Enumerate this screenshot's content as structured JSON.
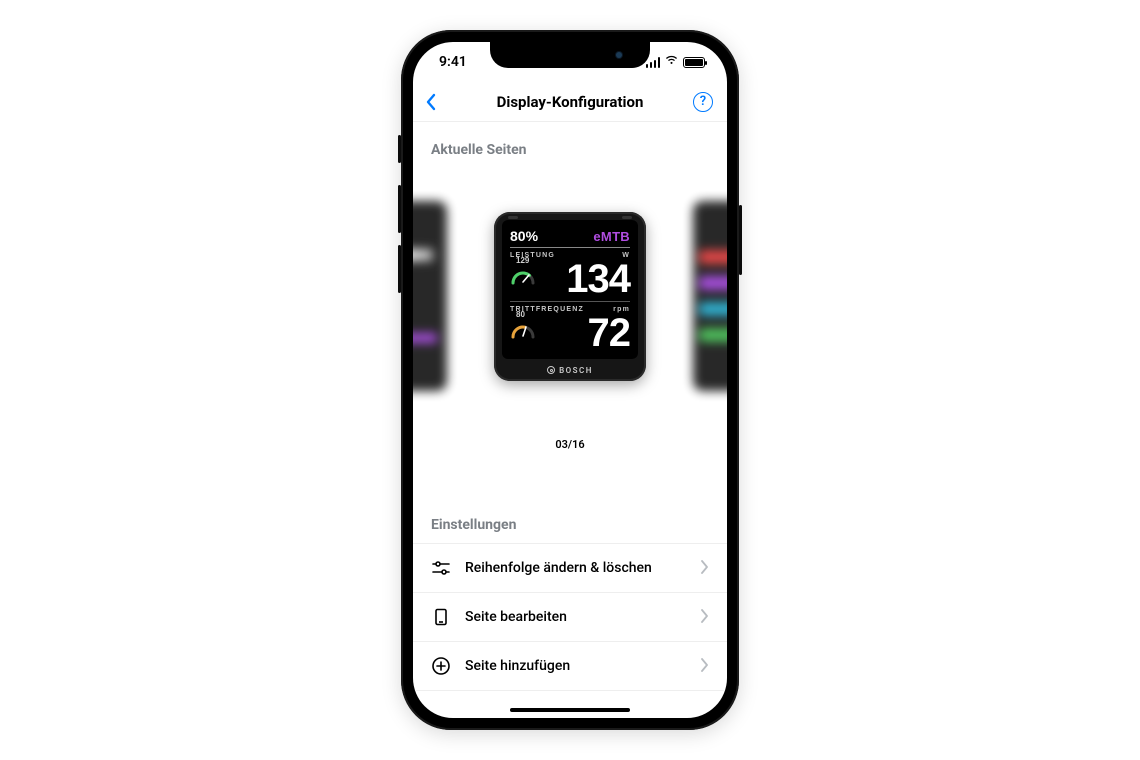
{
  "status_bar": {
    "time": "9:41"
  },
  "navbar": {
    "title": "Display-Konfiguration"
  },
  "sections": {
    "current_pages": "Aktuelle Seiten",
    "settings": "Einstellungen"
  },
  "carousel": {
    "page_counter": "03/16",
    "device": {
      "brand": "BOSCH",
      "battery_percent": "80%",
      "mode": "eMTB",
      "metric1": {
        "label": "LEISTUNG",
        "unit": "W",
        "gauge_value": "129",
        "value": "134"
      },
      "metric2": {
        "label": "TRITTFREQUENZ",
        "unit": "rpm",
        "gauge_value": "80",
        "value": "72"
      }
    }
  },
  "settings_items": [
    {
      "id": "reorder",
      "label": "Reihenfolge ändern & löschen"
    },
    {
      "id": "edit",
      "label": "Seite bearbeiten"
    },
    {
      "id": "add",
      "label": "Seite hinzufügen"
    }
  ],
  "colors": {
    "accent": "#007aff",
    "mode": "#b04de0"
  }
}
